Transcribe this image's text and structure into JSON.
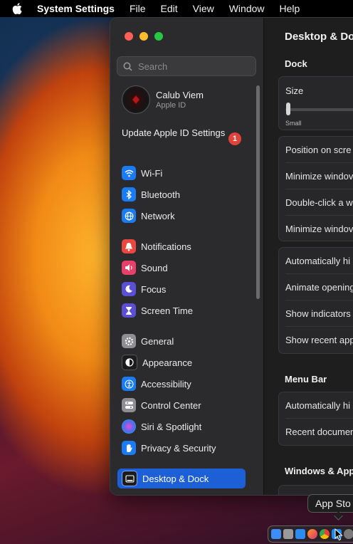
{
  "menubar": {
    "app_name": "System Settings",
    "items": [
      "File",
      "Edit",
      "View",
      "Window",
      "Help"
    ]
  },
  "sidebar": {
    "search_placeholder": "Search",
    "profile": {
      "name": "Calub Viem",
      "subtitle": "Apple ID"
    },
    "update": {
      "label": "Update Apple ID Settings",
      "badge": "1"
    },
    "items": [
      {
        "label": "Wi-Fi",
        "icon": "wifi-icon",
        "color": "#1a7cf5"
      },
      {
        "label": "Bluetooth",
        "icon": "bluetooth-icon",
        "color": "#1a7cf5"
      },
      {
        "label": "Network",
        "icon": "globe-icon",
        "color": "#1a7cf5"
      },
      {
        "label": "Notifications",
        "icon": "bell-icon",
        "color": "#e9473f"
      },
      {
        "label": "Sound",
        "icon": "speaker-icon",
        "color": "#e9406a"
      },
      {
        "label": "Focus",
        "icon": "moon-icon",
        "color": "#5b4fd3"
      },
      {
        "label": "Screen Time",
        "icon": "hourglass-icon",
        "color": "#5b4fd3"
      },
      {
        "label": "General",
        "icon": "gear-icon",
        "color": "#8e8e93"
      },
      {
        "label": "Appearance",
        "icon": "appearance-icon",
        "color": "#1c1c1e"
      },
      {
        "label": "Accessibility",
        "icon": "accessibility-icon",
        "color": "#1a7cf5"
      },
      {
        "label": "Control Center",
        "icon": "control-center-icon",
        "color": "#8e8e93"
      },
      {
        "label": "Siri & Spotlight",
        "icon": "siri-icon",
        "color": "#7a3ad9"
      },
      {
        "label": "Privacy & Security",
        "icon": "hand-icon",
        "color": "#1a7cf5"
      },
      {
        "label": "Desktop & Dock",
        "icon": "dock-icon",
        "color": "#1c1c1e",
        "selected": true
      }
    ]
  },
  "content": {
    "title": "Desktop & Do",
    "dock_section": "Dock",
    "size_label": "Size",
    "size_small": "Small",
    "rows_group1": [
      "Position on scre",
      "Minimize windov",
      "Double-click a w",
      "Minimize windov"
    ],
    "rows_group2": [
      "Automatically hi",
      "Animate opening",
      "Show indicators",
      "Show recent app"
    ],
    "menubar_section": "Menu Bar",
    "rows_group3": [
      "Automatically hi",
      "Recent documen"
    ],
    "windows_section": "Windows & App"
  },
  "dock": {
    "tooltip": "App Sto"
  }
}
